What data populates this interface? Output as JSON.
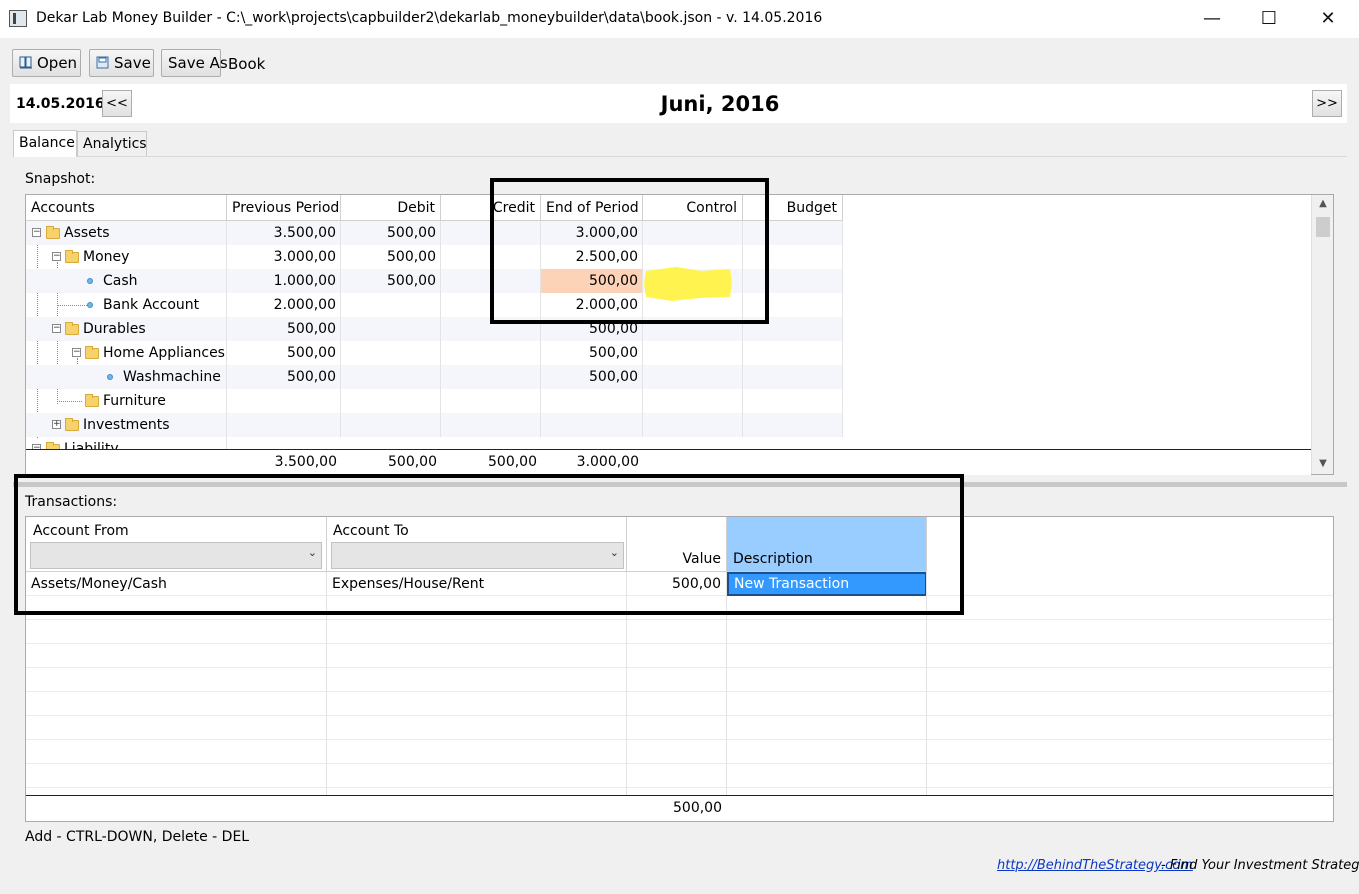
{
  "window": {
    "title": "Dekar Lab Money Builder - C:\\_work\\projects\\capbuilder2\\dekarlab_moneybuilder\\data\\book.json - v. 14.05.2016",
    "minimize_glyph": "—",
    "maximize_glyph": "☐",
    "close_glyph": "✕"
  },
  "toolbar": {
    "open_label": "Open",
    "save_label": "Save",
    "save_as_label": "Save As",
    "book_label": "Book"
  },
  "period": {
    "date": "14.05.2016",
    "prev_label": "<<",
    "next_label": ">>",
    "month_title": "Juni, 2016"
  },
  "tabs": [
    {
      "label": "Balance",
      "selected": true
    },
    {
      "label": "Analytics",
      "selected": false
    }
  ],
  "snapshot": {
    "label": "Snapshot:",
    "columns": [
      "Accounts",
      "Previous Period",
      "Debit",
      "Credit",
      "End of Period",
      "Control",
      "Budget"
    ],
    "rows": [
      {
        "name": "Assets",
        "prev": "3.500,00",
        "debit": "500,00",
        "credit": "",
        "end": "3.000,00",
        "control": "",
        "budget": ""
      },
      {
        "name": "Money",
        "prev": "3.000,00",
        "debit": "500,00",
        "credit": "",
        "end": "2.500,00",
        "control": "",
        "budget": ""
      },
      {
        "name": "Cash",
        "prev": "1.000,00",
        "debit": "500,00",
        "credit": "",
        "end": "500,00",
        "control": "",
        "budget": ""
      },
      {
        "name": "Bank Account",
        "prev": "2.000,00",
        "debit": "",
        "credit": "",
        "end": "2.000,00",
        "control": "",
        "budget": ""
      },
      {
        "name": "Durables",
        "prev": "500,00",
        "debit": "",
        "credit": "",
        "end": "500,00",
        "control": "",
        "budget": ""
      },
      {
        "name": "Home Appliances",
        "prev": "500,00",
        "debit": "",
        "credit": "",
        "end": "500,00",
        "control": "",
        "budget": ""
      },
      {
        "name": "Washmachine",
        "prev": "500,00",
        "debit": "",
        "credit": "",
        "end": "500,00",
        "control": "",
        "budget": ""
      },
      {
        "name": "Furniture",
        "prev": "",
        "debit": "",
        "credit": "",
        "end": "",
        "control": "",
        "budget": ""
      },
      {
        "name": "Investments",
        "prev": "",
        "debit": "",
        "credit": "",
        "end": "",
        "control": "",
        "budget": ""
      },
      {
        "name": "Liability",
        "prev": "",
        "debit": "",
        "credit": "",
        "end": "",
        "control": "",
        "budget": ""
      }
    ],
    "totals": {
      "prev": "3.500,00",
      "debit": "500,00",
      "credit": "500,00",
      "end": "3.000,00"
    },
    "highlight_color": "#fdd3b8"
  },
  "transactions": {
    "label": "Transactions:",
    "columns": [
      "Account From",
      "Account To",
      "Value",
      "Description"
    ],
    "rows": [
      {
        "from": "Assets/Money/Cash",
        "to": "Expenses/House/Rent",
        "value": "500,00",
        "description": "New Transaction"
      }
    ],
    "total": "500,00",
    "selection_color": "#3399ff",
    "header_highlight_color": "#99ccff"
  },
  "hint": "Add - CTRL-DOWN, Delete - DEL",
  "footer": {
    "link": "http://BehindTheStrategy.com",
    "tagline": "- Find Your Investment Strategy"
  },
  "annotation_color": "#fff44f"
}
